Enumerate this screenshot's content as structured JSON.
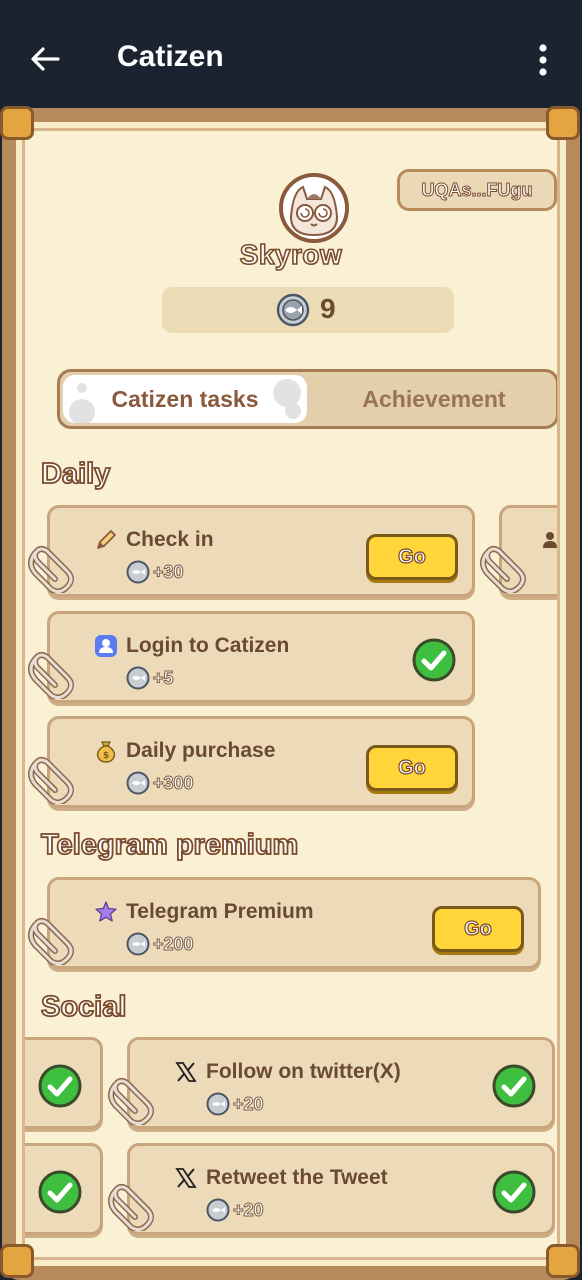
{
  "app": {
    "title": "Catizen"
  },
  "icons": {
    "back": "back-arrow-icon",
    "more": "more-vertical-icon",
    "coin": "fish-coin-icon",
    "check": "check-circle-icon"
  },
  "profile": {
    "username": "Skyrow",
    "wallet": "UQAs...FUgu",
    "coins": "9"
  },
  "tabs": {
    "active": "Catizen tasks",
    "inactive": "Achievement"
  },
  "sections": {
    "daily": "Daily",
    "premium": "Telegram premium",
    "social": "Social"
  },
  "tasks": {
    "daily": [
      {
        "label": "Check in",
        "reward": "+30",
        "action": "Go",
        "icon": "pencil-icon"
      },
      {
        "label": "Login to Catizen",
        "reward": "+5",
        "status": "done",
        "icon": "user-badge-icon"
      },
      {
        "label": "Daily purchase",
        "reward": "+300",
        "action": "Go",
        "icon": "money-bag-icon"
      }
    ],
    "premium": [
      {
        "label": "Telegram Premium",
        "reward": "+200",
        "action": "Go",
        "icon": "star-icon"
      }
    ],
    "social": [
      {
        "label": "Follow on twitter(X)",
        "reward": "+20",
        "status": "done",
        "icon": "x-logo-icon"
      },
      {
        "label": "Retweet the Tweet",
        "reward": "+20",
        "status": "done",
        "icon": "x-logo-icon"
      }
    ]
  },
  "colors": {
    "frame": "#b78a5c",
    "card": "#ecdab8",
    "go_button": "#ffd53a",
    "check": "#3fbf3f"
  }
}
